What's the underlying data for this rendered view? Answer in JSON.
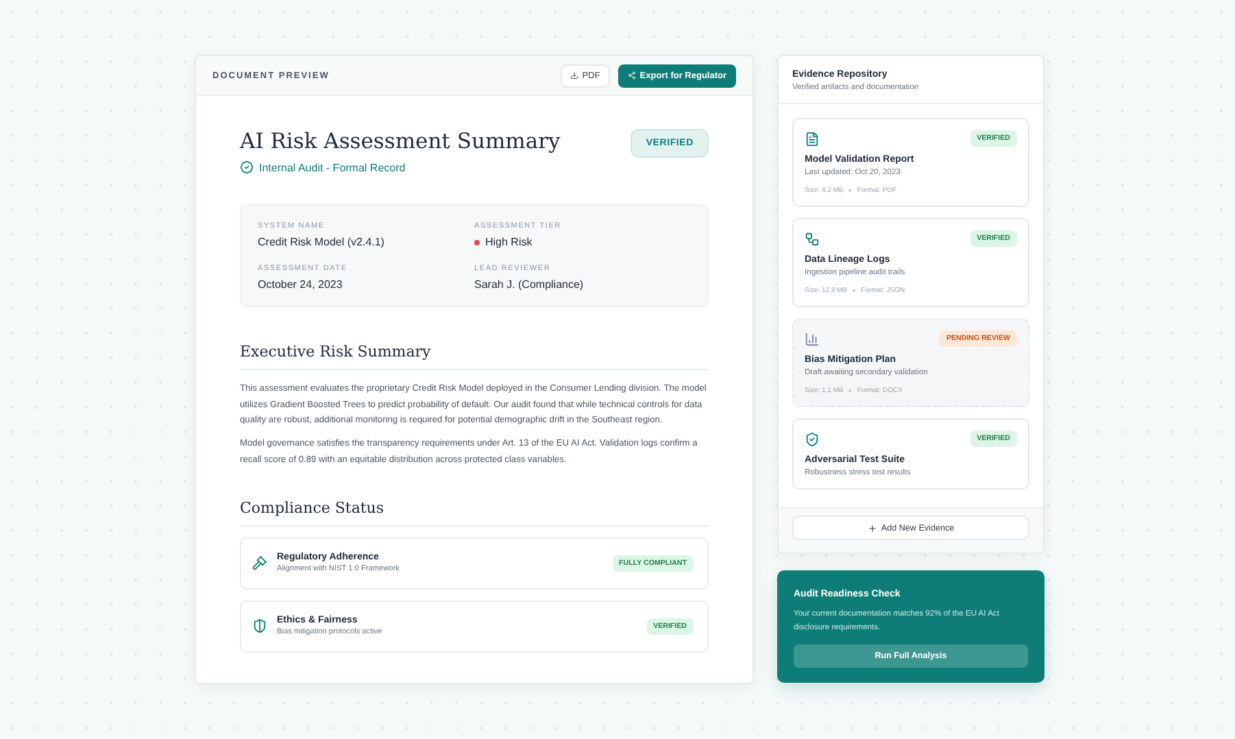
{
  "document": {
    "header_label": "DOCUMENT PREVIEW",
    "pdf_button": "PDF",
    "export_button": "Export for Regulator",
    "title": "AI Risk Assessment Summary",
    "subtitle": "Internal Audit - Formal Record",
    "status_badge": "VERIFIED",
    "info": [
      {
        "label": "SYSTEM NAME",
        "value": "Credit Risk Model (v2.4.1)"
      },
      {
        "label": "ASSESSMENT TIER",
        "value": "High Risk",
        "color": "#e5484d"
      },
      {
        "label": "ASSESSMENT DATE",
        "value": "October 24, 2023"
      },
      {
        "label": "LEAD REVIEWER",
        "value": "Sarah J. (Compliance)"
      }
    ],
    "summary_heading": "Executive Risk Summary",
    "paragraphs": [
      "This assessment evaluates the proprietary Credit Risk Model deployed in the Consumer Lending division. The model utilizes Gradient Boosted Trees to predict probability of default. Our audit found that while technical controls for data quality are robust, additional monitoring is required for potential demographic drift in the Southeast region.",
      "Model governance satisfies the transparency requirements under Art. 13 of the EU AI Act. Validation logs confirm a recall score of 0.89 with an equitable distribution across protected class variables."
    ],
    "compliance_heading": "Compliance Status",
    "compliance": [
      {
        "kind": "gavel",
        "title": "Regulatory Adherence",
        "detail": "Alignment with NIST 1.0 Framework",
        "badge": "FULLY COMPLIANT"
      },
      {
        "kind": "shield",
        "title": "Ethics & Fairness",
        "detail": "Bias mitigation protocols active",
        "badge": "VERIFIED"
      }
    ]
  },
  "evidence": {
    "title": "Evidence Repository",
    "subtitle": "Verified artifacts and documentation",
    "items": [
      {
        "kind": "file",
        "pending": false,
        "badge": "VERIFIED",
        "title": "Model Validation Report",
        "detail": "Last updated: Oct 20, 2023",
        "size": "Size: 4.2 MB",
        "format": "Format: PDF"
      },
      {
        "kind": "lineage",
        "pending": false,
        "badge": "VERIFIED",
        "title": "Data Lineage Logs",
        "detail": "Ingestion pipeline audit trails",
        "size": "Size: 12.8 MB",
        "format": "Format: JSON"
      },
      {
        "kind": "chart",
        "pending": true,
        "badge": "PENDING REVIEW",
        "title": "Bias Mitigation Plan",
        "detail": "Draft awaiting secondary validation",
        "size": "Size: 1.1 MB",
        "format": "Format: DOCX"
      },
      {
        "kind": "shield",
        "pending": false,
        "badge": "VERIFIED",
        "title": "Adversarial Test Suite",
        "detail": "Robustness stress test results"
      }
    ],
    "add_button": "Add New Evidence"
  },
  "readiness": {
    "title": "Audit Readiness Check",
    "text": "Your current documentation matches 92% of the EU AI Act disclosure requirements.",
    "button": "Run Full Analysis"
  }
}
